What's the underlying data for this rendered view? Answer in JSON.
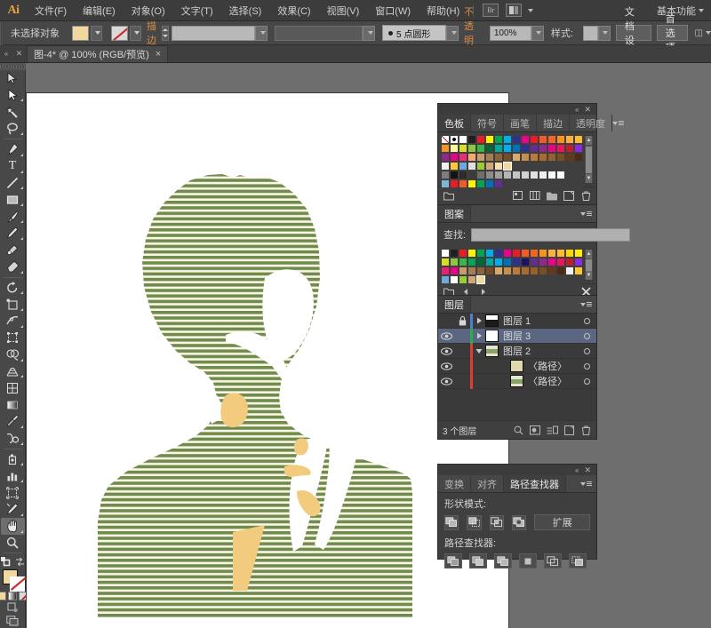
{
  "app": {
    "logo": "Ai",
    "workspace": "基本功能"
  },
  "menubar": {
    "items": [
      {
        "label": "文件(F)"
      },
      {
        "label": "编辑(E)"
      },
      {
        "label": "对象(O)"
      },
      {
        "label": "文字(T)"
      },
      {
        "label": "选择(S)"
      },
      {
        "label": "效果(C)"
      },
      {
        "label": "视图(V)"
      },
      {
        "label": "窗口(W)"
      },
      {
        "label": "帮助(H)"
      }
    ],
    "bridge_icon": "bridge-icon",
    "arrange_icon": "arrange-documents-icon"
  },
  "controlbar": {
    "selection_status": "未选择对象",
    "fill_color": "#f2d79e",
    "stroke_label": "描边",
    "stroke_weight_value": "",
    "stroke_profile_value": "",
    "brush_definition": "5 点圆形",
    "opacity_label": "不透明度",
    "opacity_value": "100%",
    "style_label": "样式:",
    "doc_setup_button": "文档设置",
    "preferences_button": "首选项"
  },
  "tabbar": {
    "document_title": "图-4* @ 100% (RGB/预览)",
    "close_glyph": "×"
  },
  "toolbar": {
    "tools": [
      {
        "name": "selection-tool",
        "glyph": "arrow"
      },
      {
        "name": "direct-selection-tool",
        "glyph": "arrow-white"
      },
      {
        "name": "magic-wand-tool",
        "glyph": "wand"
      },
      {
        "name": "lasso-tool",
        "glyph": "lasso"
      },
      {
        "name": "pen-tool",
        "glyph": "pen"
      },
      {
        "name": "type-tool",
        "glyph": "T"
      },
      {
        "name": "line-segment-tool",
        "glyph": "line"
      },
      {
        "name": "rectangle-tool",
        "glyph": "rect"
      },
      {
        "name": "paintbrush-tool",
        "glyph": "brush"
      },
      {
        "name": "pencil-tool",
        "glyph": "pencil"
      },
      {
        "name": "blob-brush-tool",
        "glyph": "blob"
      },
      {
        "name": "eraser-tool",
        "glyph": "eraser"
      },
      {
        "name": "rotate-tool",
        "glyph": "rotate"
      },
      {
        "name": "scale-tool",
        "glyph": "scale"
      },
      {
        "name": "width-tool",
        "glyph": "width"
      },
      {
        "name": "free-transform-tool",
        "glyph": "transform"
      },
      {
        "name": "shape-builder-tool",
        "glyph": "shapebuilder"
      },
      {
        "name": "perspective-grid-tool",
        "glyph": "perspective"
      },
      {
        "name": "mesh-tool",
        "glyph": "mesh"
      },
      {
        "name": "gradient-tool",
        "glyph": "gradient"
      },
      {
        "name": "eyedropper-tool",
        "glyph": "eyedropper"
      },
      {
        "name": "blend-tool",
        "glyph": "blend"
      },
      {
        "name": "symbol-sprayer-tool",
        "glyph": "symbol"
      },
      {
        "name": "column-graph-tool",
        "glyph": "graph"
      },
      {
        "name": "artboard-tool",
        "glyph": "artboard"
      },
      {
        "name": "slice-tool",
        "glyph": "slice"
      },
      {
        "name": "hand-tool",
        "glyph": "hand",
        "selected": true
      },
      {
        "name": "zoom-tool",
        "glyph": "zoom"
      }
    ],
    "fill_color": "#f2d79e",
    "stroke_color": "none"
  },
  "swatches_panel": {
    "tabs": [
      {
        "label": "色板",
        "active": true
      },
      {
        "label": "符号",
        "active": false
      },
      {
        "label": "画笔",
        "active": false
      },
      {
        "label": "描边",
        "active": false
      },
      {
        "label": "透明度",
        "active": false
      }
    ],
    "rows": [
      [
        "none",
        "registration",
        "#ffffff",
        "#231f20",
        "#ed1c24",
        "#fff200",
        "#00a651",
        "#00aeef",
        "#2e3192",
        "#ec008c",
        "#ed1c24",
        "#f15a29",
        "#f26522",
        "#f7941e",
        "#fbb040",
        "#fdbb30"
      ],
      [
        "#f7941e",
        "#fff799",
        "#d7df23",
        "#8dc63f",
        "#39b54a",
        "#006838",
        "#00a99d",
        "#00aeef",
        "#0072bc",
        "#2e3192",
        "#662d91",
        "#92278f",
        "#ec008c",
        "#ed145b",
        "#be1e2d",
        "#8a2be2"
      ],
      [
        "#92278f",
        "#ed008c",
        "#ee2a7b",
        "#f9a870",
        "#c69c6d",
        "#a67c52",
        "#8c6239",
        "#754c24",
        "#d9a86c",
        "#c78f4e",
        "#b97a3a",
        "#a86b2d",
        "#96602a",
        "#7a4d22",
        "#663a18",
        "#4d2a10"
      ],
      [
        "#f0f0f0",
        "#fdc830",
        "#6fa8dc",
        "#e0e0e0",
        "#9acd32",
        "#d2a679",
        "#f5deb3",
        "#f2d79e",
        "#3f3f3f",
        "#3f3f3f",
        "#3f3f3f",
        "#3f3f3f",
        "#3f3f3f",
        "#3f3f3f",
        "#3f3f3f",
        "#3f3f3f"
      ],
      [
        "#7d7d7d",
        "#141414",
        "#2b2b2b",
        "#3b3b3b",
        "#6e6e6e",
        "#8c8c8c",
        "#a0a0a0",
        "#b4b4b4",
        "#c4c4c4",
        "#d2d2d2",
        "#e0e0e0",
        "#eeeeee",
        "#fafafa",
        "#ffffff",
        "#3f3f3f",
        "#3f3f3f"
      ],
      [
        "#7cb7d4",
        "#ed1c24",
        "#f15a29",
        "#fff200",
        "#00a651",
        "#0072bc",
        "#662d91",
        "#3f3f3f",
        "#3f3f3f",
        "#3f3f3f",
        "#3f3f3f",
        "#3f3f3f",
        "#3f3f3f",
        "#3f3f3f",
        "#3f3f3f",
        "#3f3f3f"
      ]
    ],
    "selected_index": {
      "row": 3,
      "col": 7
    },
    "footer_icons": [
      "swatch-libraries-icon",
      "show-swatch-kinds-icon",
      "swatch-options-icon",
      "new-color-group-icon",
      "new-swatch-icon",
      "delete-swatch-icon"
    ]
  },
  "pattern_panel": {
    "tab_label": "图案",
    "find_label": "查找:",
    "find_value": "",
    "rows": [
      [
        "#ffffff",
        "#231f20",
        "#ed1c24",
        "#fff200",
        "#00a651",
        "#00aeef",
        "#2e3192",
        "#ec008c",
        "#ed1c24",
        "#f15a29",
        "#f26522",
        "#f7941e",
        "#fbb040",
        "#fdbb30",
        "#ffd700",
        "#fff200"
      ],
      [
        "#d7df23",
        "#8dc63f",
        "#39b54a",
        "#00a651",
        "#006838",
        "#00a99d",
        "#00aeef",
        "#0072bc",
        "#2e3192",
        "#1b1464",
        "#662d91",
        "#92278f",
        "#ec008c",
        "#ed145b",
        "#be1e2d",
        "#8a2be2"
      ],
      [
        "#ed1e79",
        "#ec008c",
        "#c69c6d",
        "#a67c52",
        "#8c6239",
        "#754c24",
        "#d9a86c",
        "#c78f4e",
        "#b97a3a",
        "#a86b2d",
        "#96602a",
        "#7a4d22",
        "#663a18",
        "#4d2a10",
        "#f0f0f0",
        "#fdc830"
      ],
      [
        "#6fa8dc",
        "#ffffff",
        "#9acd32",
        "#d2a679",
        "#f2d79e",
        "#3f3f3f",
        "#3f3f3f",
        "#3f3f3f",
        "#3f3f3f",
        "#3f3f3f",
        "#3f3f3f",
        "#3f3f3f",
        "#3f3f3f",
        "#3f3f3f",
        "#3f3f3f",
        "#3f3f3f"
      ]
    ],
    "selected_index": {
      "row": 3,
      "col": 4
    },
    "footer_icons": [
      "libraries-icon",
      "prev-icon",
      "next-icon",
      "close-x-icon"
    ]
  },
  "layers_panel": {
    "tab_label": "图层",
    "layers": [
      {
        "name": "图层 1",
        "visible": false,
        "locked": true,
        "color": "#4a7fd4",
        "expandable": true,
        "expanded": false,
        "selected": false,
        "thumb": "dark",
        "indent": 0
      },
      {
        "name": "图层 3",
        "visible": true,
        "locked": false,
        "color": "#22b14c",
        "expandable": true,
        "expanded": false,
        "selected": true,
        "thumb": "white",
        "indent": 0
      },
      {
        "name": "图层 2",
        "visible": true,
        "locked": false,
        "color": "#e03c31",
        "expandable": true,
        "expanded": true,
        "selected": false,
        "thumb": "art",
        "indent": 0
      },
      {
        "name": "〈路径〉",
        "visible": true,
        "locked": false,
        "color": "#e03c31",
        "expandable": false,
        "expanded": false,
        "selected": false,
        "thumb": "tan",
        "indent": 1
      },
      {
        "name": "〈路径〉",
        "visible": true,
        "locked": false,
        "color": "#e03c31",
        "expandable": false,
        "expanded": false,
        "selected": false,
        "thumb": "art",
        "indent": 1
      }
    ],
    "footer_text": "3 个图层",
    "footer_icons": [
      "locate-object-icon",
      "make-clipping-mask-icon",
      "create-new-sublayer-icon",
      "create-new-layer-icon",
      "delete-selection-icon"
    ]
  },
  "pathfinder_panel": {
    "tabs": [
      {
        "label": "变换",
        "active": false
      },
      {
        "label": "对齐",
        "active": false
      },
      {
        "label": "路径查找器",
        "active": true
      }
    ],
    "shape_modes_label": "形状模式:",
    "shape_mode_buttons": [
      "unite-icon",
      "minus-front-icon",
      "intersect-icon",
      "exclude-icon"
    ],
    "expand_button": "扩展",
    "pathfinders_label": "路径查找器:",
    "pathfinder_buttons": [
      "divide-icon",
      "trim-icon",
      "merge-icon",
      "crop-icon",
      "outline-icon",
      "minus-back-icon"
    ]
  },
  "artwork": {
    "stripe_color": "#6f8c4e",
    "stripe_bg": "#fbf7e4",
    "accent_color": "#f2cb7f",
    "page_color": "#ffffff",
    "description": "striped-portrait-silhouette"
  }
}
